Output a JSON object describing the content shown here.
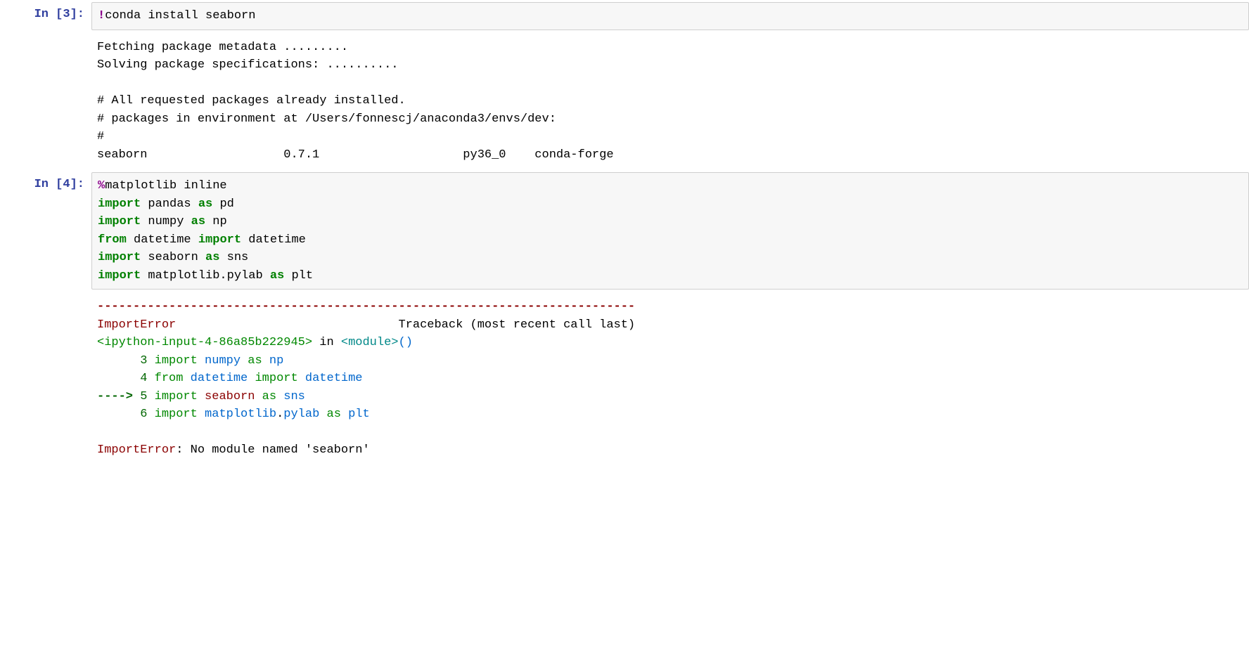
{
  "cell1": {
    "prompt": "In [3]:",
    "code": {
      "bang": "!",
      "text": "conda install seaborn"
    },
    "output": "Fetching package metadata .........\nSolving package specifications: ..........\n\n# All requested packages already installed.\n# packages in environment at /Users/fonnescj/anaconda3/envs/dev:\n#\nseaborn                   0.7.1                    py36_0    conda-forge"
  },
  "cell2": {
    "prompt": "In [4]:",
    "code": {
      "line1_magic": "%",
      "line1_text": "matplotlib inline",
      "line2_kw": "import",
      "line2_mid": " pandas ",
      "line2_as": "as",
      "line2_end": " pd",
      "line3_kw": "import",
      "line3_mid": " numpy ",
      "line3_as": "as",
      "line3_end": " np",
      "line4_from": "from",
      "line4_mid1": " datetime ",
      "line4_imp": "import",
      "line4_mid2": " datetime",
      "line5_kw": "import",
      "line5_mid": " seaborn ",
      "line5_as": "as",
      "line5_end": " sns",
      "line6_kw": "import",
      "line6_mid": " matplotlib.pylab ",
      "line6_as": "as",
      "line6_end": " plt"
    },
    "traceback": {
      "dashes": "---------------------------------------------------------------------------",
      "error_name": "ImportError",
      "header_right": "                               Traceback (most recent call last)",
      "frame_file": "<ipython-input-4-86a85b222945>",
      "frame_in": " in ",
      "frame_loc": "<module>",
      "frame_paren": "()",
      "l3_no": "      3",
      "l3_imp": " import ",
      "l3_mod": "numpy",
      "l3_as": " as ",
      "l3_alias": "np",
      "l4_no": "      4",
      "l4_from": " from ",
      "l4_mod1": "datetime",
      "l4_imp": " import ",
      "l4_mod2": "datetime",
      "l5_arrow": "----> ",
      "l5_no": "5",
      "l5_imp": " import ",
      "l5_mod": "seaborn",
      "l5_as": " as ",
      "l5_alias": "sns",
      "l6_no": "      6",
      "l6_imp": " import ",
      "l6_mod": "matplotlib",
      "l6_dot": ".",
      "l6_mod2": "pylab",
      "l6_as": " as ",
      "l6_alias": "plt",
      "final_name": "ImportError",
      "final_sep": ": ",
      "final_msg": "No module named 'seaborn'"
    }
  }
}
